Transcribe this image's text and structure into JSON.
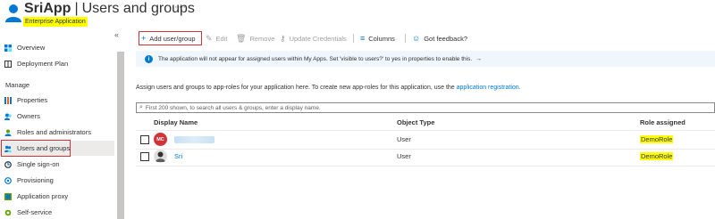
{
  "header": {
    "app_name": "SriApp",
    "separator": "|",
    "page": "Users and groups",
    "more": "···",
    "subtitle": "Enterprise Application"
  },
  "sidebar": {
    "collapse": "«",
    "items_top": [
      {
        "label": "Overview",
        "icon": "overview-icon"
      },
      {
        "label": "Deployment Plan",
        "icon": "book-icon"
      }
    ],
    "section": "Manage",
    "items_manage": [
      {
        "label": "Properties",
        "icon": "properties-icon"
      },
      {
        "label": "Owners",
        "icon": "owners-icon"
      },
      {
        "label": "Roles and administrators",
        "icon": "roles-icon"
      },
      {
        "label": "Users and groups",
        "icon": "users-groups-icon",
        "active": true
      },
      {
        "label": "Single sign-on",
        "icon": "sso-icon"
      },
      {
        "label": "Provisioning",
        "icon": "provisioning-icon"
      },
      {
        "label": "Application proxy",
        "icon": "app-proxy-icon"
      },
      {
        "label": "Self-service",
        "icon": "self-service-icon"
      }
    ]
  },
  "toolbar": {
    "add": "Add user/group",
    "edit": "Edit",
    "remove": "Remove",
    "update": "Update Credentials",
    "columns": "Columns",
    "feedback": "Got feedback?"
  },
  "banner": {
    "text": "The application will not appear for assigned users within My Apps. Set 'visible to users?' to yes in properties to enable this.",
    "arrow": "→"
  },
  "description": {
    "text": "Assign users and groups to app-roles for your application here. To create new app-roles for this application, use the ",
    "link": "application registration",
    "end": "."
  },
  "search": {
    "placeholder": "First 200 shown, to search all users & groups, enter a display name."
  },
  "table": {
    "columns": [
      "Display Name",
      "Object Type",
      "Role assigned"
    ],
    "rows": [
      {
        "initials": "MC",
        "name": "",
        "type": "User",
        "role": "DemoRole"
      },
      {
        "initials": "",
        "name": "Sri",
        "type": "User",
        "role": "DemoRole"
      }
    ]
  },
  "colors": {
    "accent": "#0078d4",
    "highlight": "#ffff00",
    "annotation": "#d13438"
  }
}
